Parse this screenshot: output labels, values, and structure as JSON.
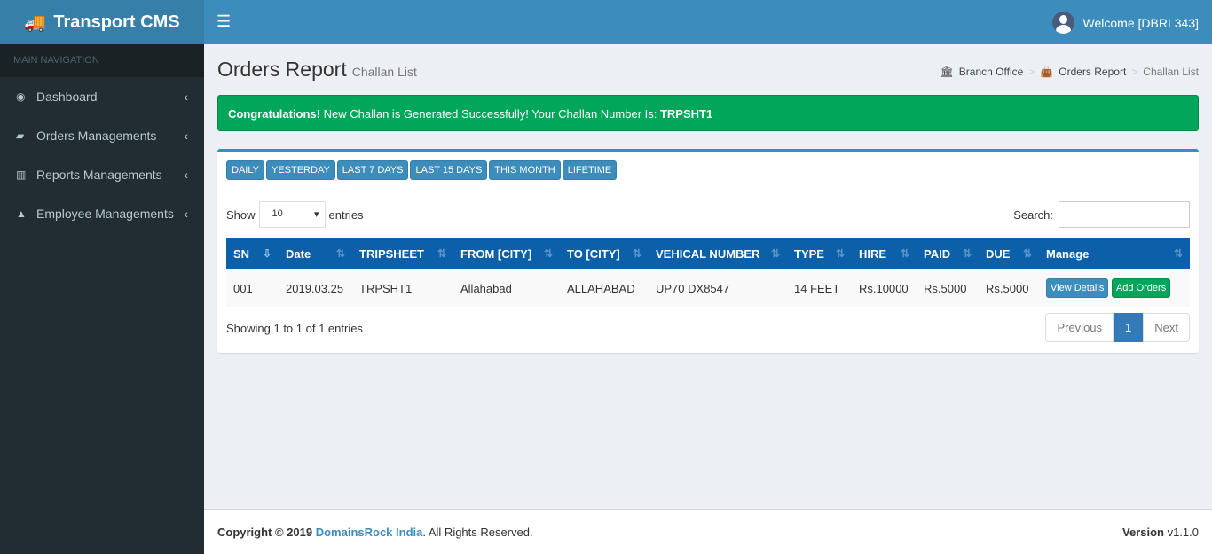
{
  "app": {
    "title": "Transport CMS",
    "welcome": "Welcome [DBRL343]"
  },
  "sidebar": {
    "header": "MAIN NAVIGATION",
    "items": [
      {
        "label": "Dashboard"
      },
      {
        "label": "Orders Managements"
      },
      {
        "label": "Reports Managements"
      },
      {
        "label": "Employee Managements"
      }
    ]
  },
  "page": {
    "title": "Orders Report",
    "subtitle": "Challan List"
  },
  "breadcrumb": [
    "Branch Office",
    "Orders Report",
    "Challan List"
  ],
  "alert": {
    "strong": "Congratulations!",
    "text": " New Challan is Generated Successfully! Your Challan Number Is: ",
    "number": "TRPSHT1"
  },
  "filters": [
    "DAILY",
    "YESTERDAY",
    "LAST 7 DAYS",
    "LAST 15 DAYS",
    "THIS MONTH",
    "LIFETIME"
  ],
  "table": {
    "show": "Show",
    "length": "10",
    "entries": "entries",
    "search_label": "Search:",
    "columns": [
      "SN",
      "Date",
      "TRIPSHEET",
      "FROM [CITY]",
      "TO [CITY]",
      "VEHICAL NUMBER",
      "TYPE",
      "HIRE",
      "PAID",
      "DUE",
      "Manage"
    ],
    "rows": [
      [
        "001",
        "2019.03.25",
        "TRPSHT1",
        "Allahabad",
        "ALLAHABAD",
        "UP70 DX8547",
        "14 FEET",
        "Rs.10000",
        "Rs.5000",
        "Rs.5000"
      ]
    ],
    "view": "View Details",
    "add": "Add Orders",
    "info": "Showing 1 to 1 of 1 entries",
    "prev": "Previous",
    "page": "1",
    "next": "Next"
  },
  "footer": {
    "copy": "Copyright © 2019 ",
    "company": "DomainsRock India",
    "rest": ". All Rights Reserved.",
    "version_label": "Version",
    "version": " v1.1.0"
  }
}
